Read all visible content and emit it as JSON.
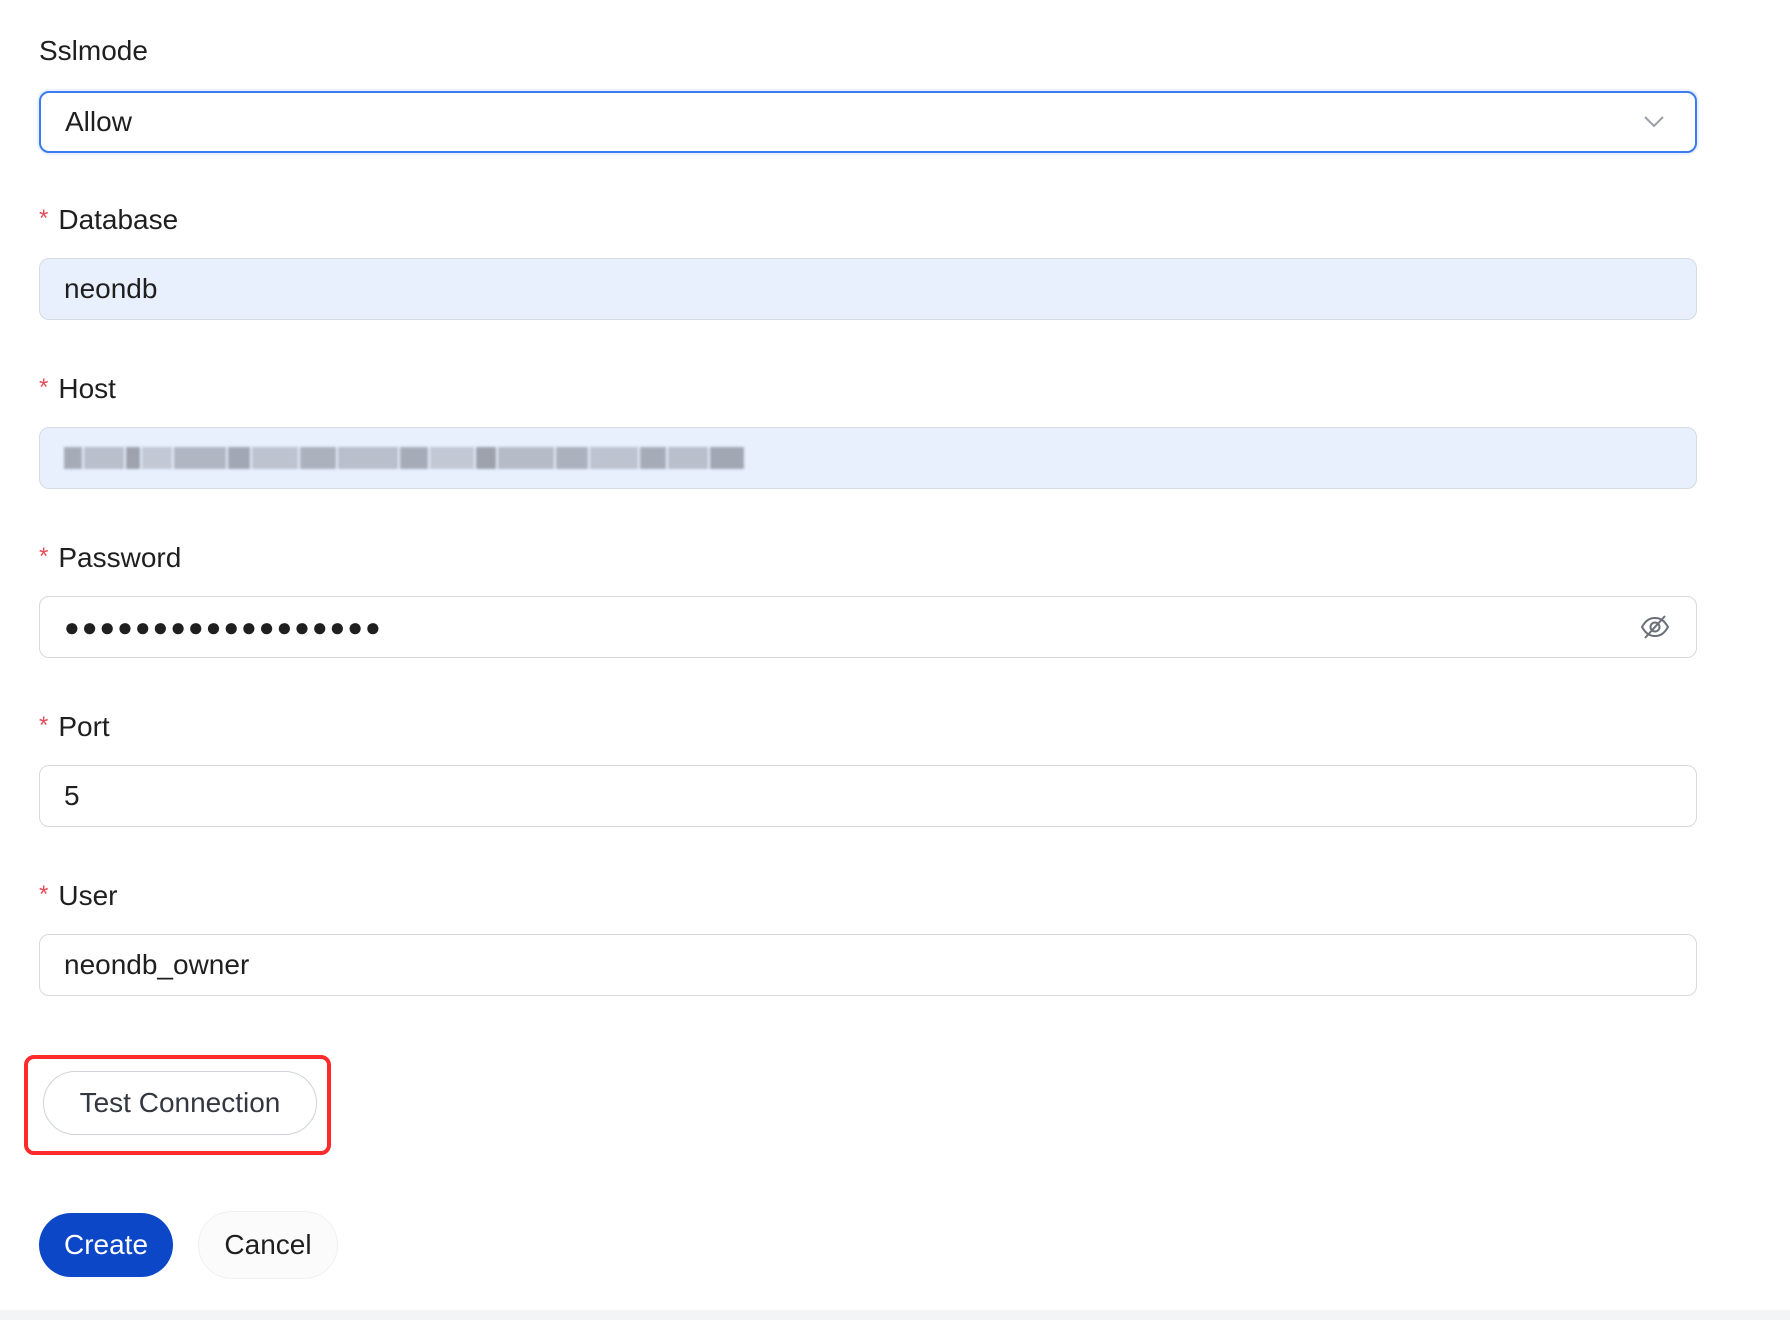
{
  "form": {
    "sslmode": {
      "label": "Sslmode",
      "value": "Allow",
      "icon": "chevron-down-icon"
    },
    "database": {
      "label": "Database",
      "required_mark": "*",
      "value": "neondb"
    },
    "host": {
      "label": "Host",
      "required_mark": "*",
      "value_redacted": true
    },
    "password": {
      "label": "Password",
      "required_mark": "*",
      "value_masked": "●●●●●●●●●●●●●●●●●●",
      "icon": "eye-off-icon"
    },
    "port": {
      "label": "Port",
      "required_mark": "*",
      "value": "5"
    },
    "user": {
      "label": "User",
      "required_mark": "*",
      "value": "neondb_owner"
    }
  },
  "actions": {
    "test_connection_label": "Test Connection",
    "create_label": "Create",
    "cancel_label": "Cancel"
  },
  "colors": {
    "primary": "#0c47c8",
    "required": "#e34d59",
    "focus_border": "#3a7bf0",
    "autofill_bg": "#e8f0fe",
    "highlight_box": "#ff2a2a"
  }
}
